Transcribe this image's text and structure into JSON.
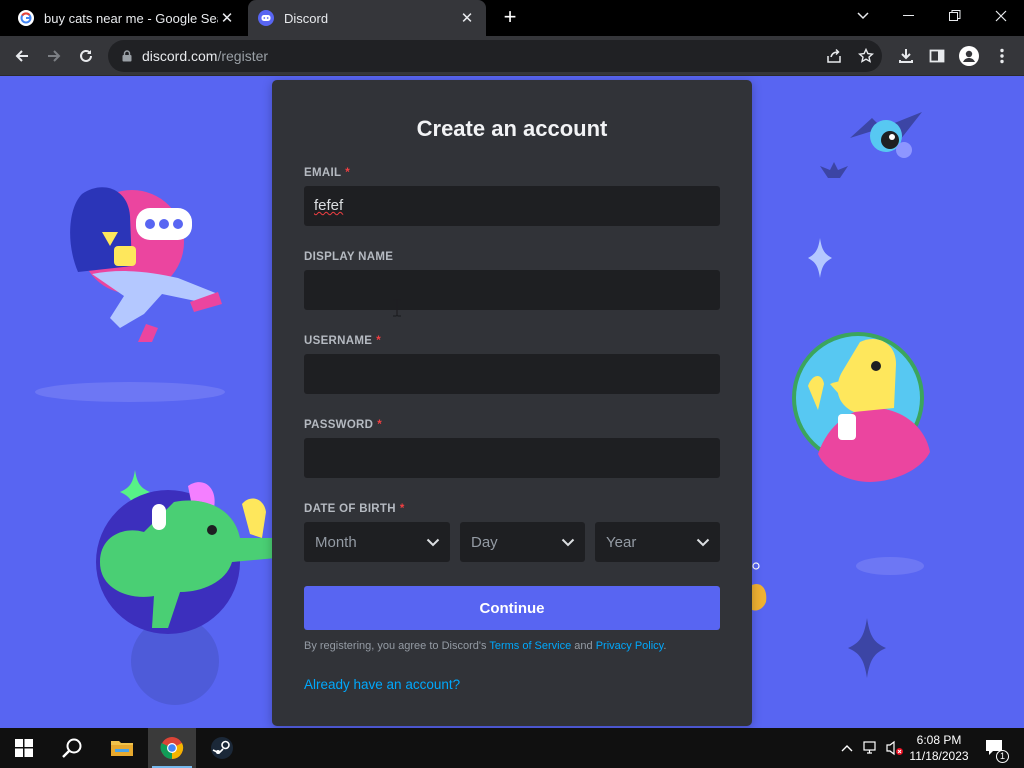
{
  "browser": {
    "tabs": [
      {
        "title": "buy cats near me - Google Search",
        "active": false
      },
      {
        "title": "Discord",
        "active": true
      }
    ],
    "url_host": "discord.com",
    "url_path": "/register"
  },
  "form": {
    "title": "Create an account",
    "required_marker": "*",
    "email": {
      "label": "EMAIL",
      "value": "fefef"
    },
    "display_name": {
      "label": "DISPLAY NAME",
      "value": ""
    },
    "username": {
      "label": "USERNAME",
      "value": ""
    },
    "password": {
      "label": "PASSWORD",
      "value": ""
    },
    "dob": {
      "label": "DATE OF BIRTH",
      "month_placeholder": "Month",
      "day_placeholder": "Day",
      "year_placeholder": "Year"
    },
    "continue_label": "Continue",
    "legal_prefix": "By registering, you agree to Discord's ",
    "terms_label": "Terms of Service",
    "legal_and": " and ",
    "privacy_label": "Privacy Policy",
    "legal_suffix": ".",
    "login_link": "Already have an account?"
  },
  "taskbar": {
    "time": "6:08 PM",
    "date": "11/18/2023",
    "notification_count": "1"
  },
  "colors": {
    "brand": "#5865f2",
    "card": "#313338",
    "input": "#1e1f22",
    "link": "#00a8fc",
    "required": "#f23f42"
  }
}
